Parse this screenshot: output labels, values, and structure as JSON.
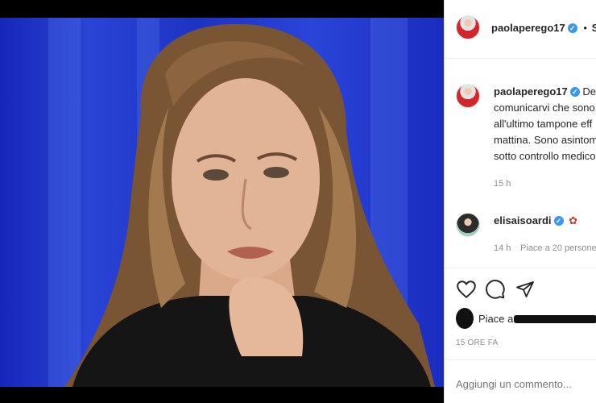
{
  "header": {
    "username": "paolaperego17",
    "follow_separator": "•",
    "follow_label": "Se"
  },
  "caption": {
    "username": "paolaperego17",
    "lines": [
      "Des",
      "comunicarvi che sono",
      "all'ultimo tampone eff",
      "mattina. Sono asintom",
      "sotto controllo medico"
    ],
    "time": "15 h"
  },
  "comment": {
    "username": "elisaisoardi",
    "time": "14 h",
    "likes": "Piace a 20 persone"
  },
  "actions": {
    "likes_prefix": "Piace a",
    "date": "15 ORE FA"
  },
  "add_comment": {
    "placeholder": "Aggiungi un commento..."
  },
  "icons": [
    "heart-icon",
    "comment-icon",
    "share-icon",
    "verified-icon",
    "rose-emoji"
  ],
  "colors": {
    "verified": "#3897f0",
    "photo_background": "#2a44d6"
  }
}
